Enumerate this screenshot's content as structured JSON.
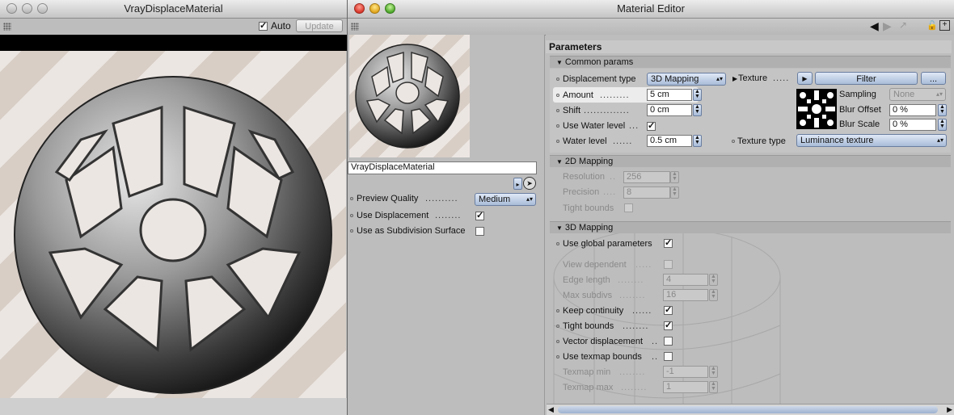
{
  "viewer": {
    "title": "VrayDisplaceMaterial",
    "auto_label": "Auto",
    "auto_checked": true,
    "update_label": "Update"
  },
  "editor": {
    "title": "Material Editor",
    "material_name": "VrayDisplaceMaterial",
    "preview_quality_label": "Preview Quality",
    "preview_quality_value": "Medium",
    "use_displacement_label": "Use Displacement",
    "use_displacement_checked": true,
    "use_subdivision_label": "Use as Subdivision Surface",
    "use_subdivision_checked": false
  },
  "params": {
    "header": "Parameters",
    "common": {
      "title": "Common params",
      "displacement_type_label": "Displacement type",
      "displacement_type_value": "3D Mapping",
      "amount_label": "Amount",
      "amount_value": "5 cm",
      "shift_label": "Shift",
      "shift_value": "0 cm",
      "use_water_label": "Use Water level",
      "water_level_label": "Water level",
      "water_level_value": "0.5 cm",
      "texture_label": "Texture",
      "filter_label": "Filter",
      "ellipsis_label": "...",
      "sampling_label": "Sampling",
      "sampling_value": "None",
      "blur_offset_label": "Blur Offset",
      "blur_offset_value": "0 %",
      "blur_scale_label": "Blur Scale",
      "blur_scale_value": "0 %",
      "texture_type_label": "Texture type",
      "texture_type_value": "Luminance texture"
    },
    "mapping2d": {
      "title": "2D Mapping",
      "resolution_label": "Resolution",
      "resolution_value": "256",
      "precision_label": "Precision",
      "precision_value": "8",
      "tight_bounds_label": "Tight bounds"
    },
    "mapping3d": {
      "title": "3D Mapping",
      "use_global_label": "Use global parameters",
      "view_dependent_label": "View dependent",
      "edge_length_label": "Edge length",
      "edge_length_value": "4",
      "max_subdivs_label": "Max subdivs",
      "max_subdivs_value": "16",
      "keep_continuity_label": "Keep continuity",
      "tight_bounds_label": "Tight bounds",
      "vector_disp_label": "Vector displacement",
      "use_texmap_bounds_label": "Use texmap bounds",
      "texmap_min_label": "Texmap min",
      "texmap_min_value": "-1",
      "texmap_max_label": "Texmap max",
      "texmap_max_value": "1"
    }
  }
}
